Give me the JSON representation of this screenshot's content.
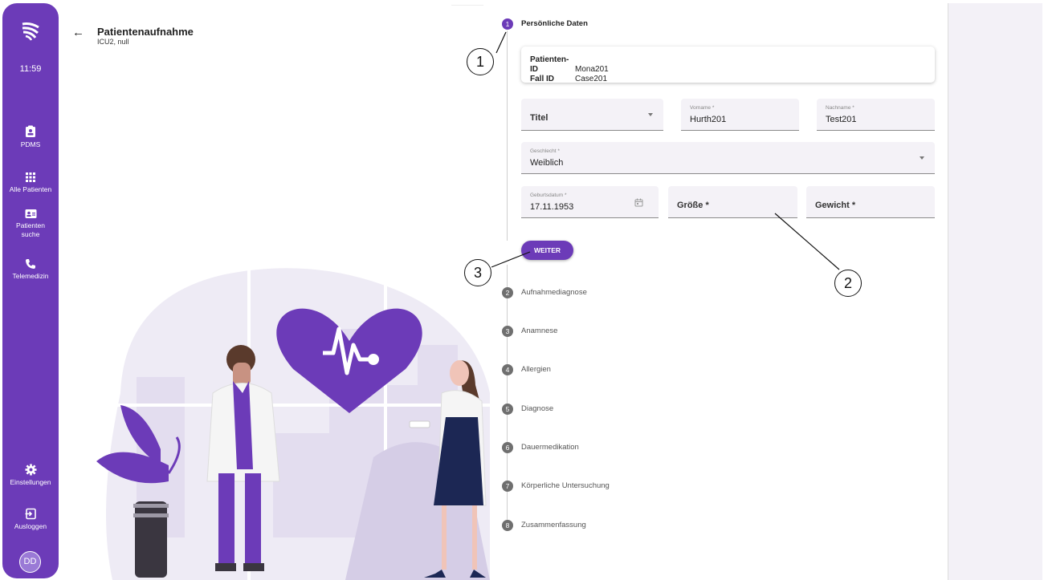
{
  "sidebar": {
    "time": "11:59",
    "items": [
      {
        "label": "PDMS",
        "icon": "clipboard-icon"
      },
      {
        "label": "Alle Patienten",
        "icon": "grid-icon"
      },
      {
        "label": "Patienten suche",
        "icon": "contact-card-icon"
      },
      {
        "label": "Telemedizin",
        "icon": "phone-icon"
      },
      {
        "label": "Einstellungen",
        "icon": "gear-icon"
      },
      {
        "label": "Ausloggen",
        "icon": "logout-icon"
      }
    ],
    "avatar": "DD",
    "accent": "#6c3bb8"
  },
  "header": {
    "title": "Patientenaufnahme",
    "subtitle": "ICU2, null"
  },
  "steps": [
    {
      "number": "1",
      "label": "Persönliche Daten",
      "active": true
    },
    {
      "number": "2",
      "label": "Aufnahmediagnose"
    },
    {
      "number": "3",
      "label": "Anamnese"
    },
    {
      "number": "4",
      "label": "Allergien"
    },
    {
      "number": "5",
      "label": "Diagnose"
    },
    {
      "number": "6",
      "label": "Dauermedikation"
    },
    {
      "number": "7",
      "label": "Körperliche Untersuchung"
    },
    {
      "number": "8",
      "label": "Zusammenfassung"
    }
  ],
  "patient": {
    "id_label": "Patienten-ID",
    "id_value": "Mona201",
    "fall_label": "Fall ID",
    "fall_value": "Case201"
  },
  "form": {
    "titel": {
      "placeholder": "Titel"
    },
    "vorname": {
      "label": "Vorname *",
      "value": "Hurth201"
    },
    "nachname": {
      "label": "Nachname *",
      "value": "Test201"
    },
    "geschlecht": {
      "label": "Geschlecht *",
      "value": "Weiblich"
    },
    "geburtsdatum": {
      "label": "Geburtsdatum *",
      "value": "17.11.1953"
    },
    "groesse": {
      "placeholder": "Größe *"
    },
    "gewicht": {
      "placeholder": "Gewicht *"
    },
    "weiter_label": "WEITER"
  },
  "callouts": [
    "1",
    "2",
    "3"
  ]
}
